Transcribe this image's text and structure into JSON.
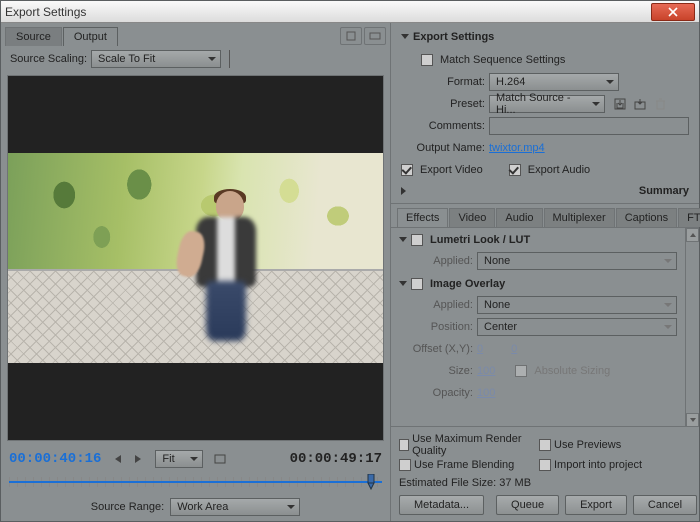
{
  "window_title": "Export Settings",
  "left": {
    "tabs": [
      "Source",
      "Output"
    ],
    "active_tab": "Output",
    "source_scaling_label": "Source Scaling:",
    "source_scaling_value": "Scale To Fit",
    "timecode_in": "00:00:40:16",
    "timecode_out": "00:00:49:17",
    "fit_label": "Fit",
    "source_range_label": "Source Range:",
    "source_range_value": "Work Area"
  },
  "export": {
    "section": "Export Settings",
    "match_seq_label": "Match Sequence Settings",
    "match_seq_checked": false,
    "format_label": "Format:",
    "format_value": "H.264",
    "preset_label": "Preset:",
    "preset_value": "Match Source - Hi...",
    "comments_label": "Comments:",
    "comments_value": "",
    "output_name_label": "Output Name:",
    "output_name_value": "twixtor.mp4",
    "export_video_label": "Export Video",
    "export_video_checked": true,
    "export_audio_label": "Export Audio",
    "export_audio_checked": true,
    "summary_label": "Summary"
  },
  "subtabs": [
    "Effects",
    "Video",
    "Audio",
    "Multiplexer",
    "Captions",
    "FTP"
  ],
  "active_subtab": "Effects",
  "effects": {
    "lut": {
      "title": "Lumetri Look / LUT",
      "applied_label": "Applied:",
      "applied_value": "None"
    },
    "overlay": {
      "title": "Image Overlay",
      "applied_label": "Applied:",
      "applied_value": "None",
      "position_label": "Position:",
      "position_value": "Center",
      "offset_label": "Offset (X,Y):",
      "offset_x": "0",
      "offset_y": "0",
      "size_label": "Size:",
      "size_value": "100",
      "absolute_label": "Absolute Sizing",
      "opacity_label": "Opacity:",
      "opacity_value": "100"
    }
  },
  "footer": {
    "max_quality": "Use Maximum Render Quality",
    "previews": "Use Previews",
    "frame_blend": "Use Frame Blending",
    "import_proj": "Import into project",
    "est_label": "Estimated File Size:",
    "est_value": "37 MB",
    "metadata_btn": "Metadata...",
    "queue_btn": "Queue",
    "export_btn": "Export",
    "cancel_btn": "Cancel"
  }
}
